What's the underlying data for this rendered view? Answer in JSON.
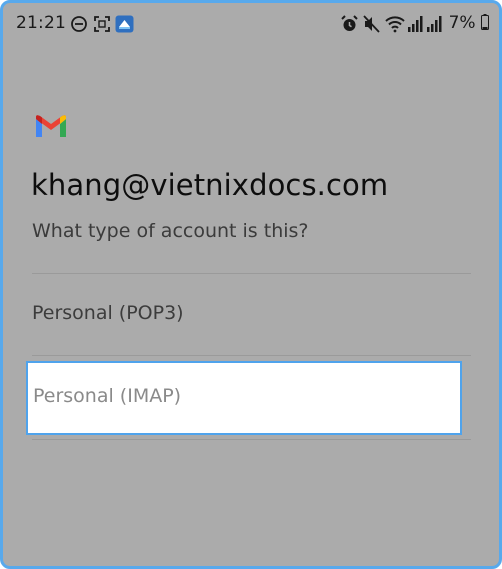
{
  "status_bar": {
    "time": "21:21",
    "battery": "7%",
    "icons": [
      "do-not-disturb-icon",
      "screenshot-icon",
      "app-notification-icon",
      "alarm-icon",
      "mute-icon",
      "wifi-icon",
      "signal-icon",
      "signal-icon",
      "battery-icon"
    ]
  },
  "app": {
    "logo": "gmail-icon"
  },
  "account": {
    "email": "khang@vietnixdocs.com",
    "question": "What type of account is this?"
  },
  "options": [
    {
      "label": "Personal (POP3)",
      "selected": false
    },
    {
      "label": "Personal (IMAP)",
      "selected": true
    }
  ],
  "colors": {
    "frame_border": "#58a9ec",
    "overlay": "#ababab",
    "selection_border": "#4fa3ec"
  }
}
